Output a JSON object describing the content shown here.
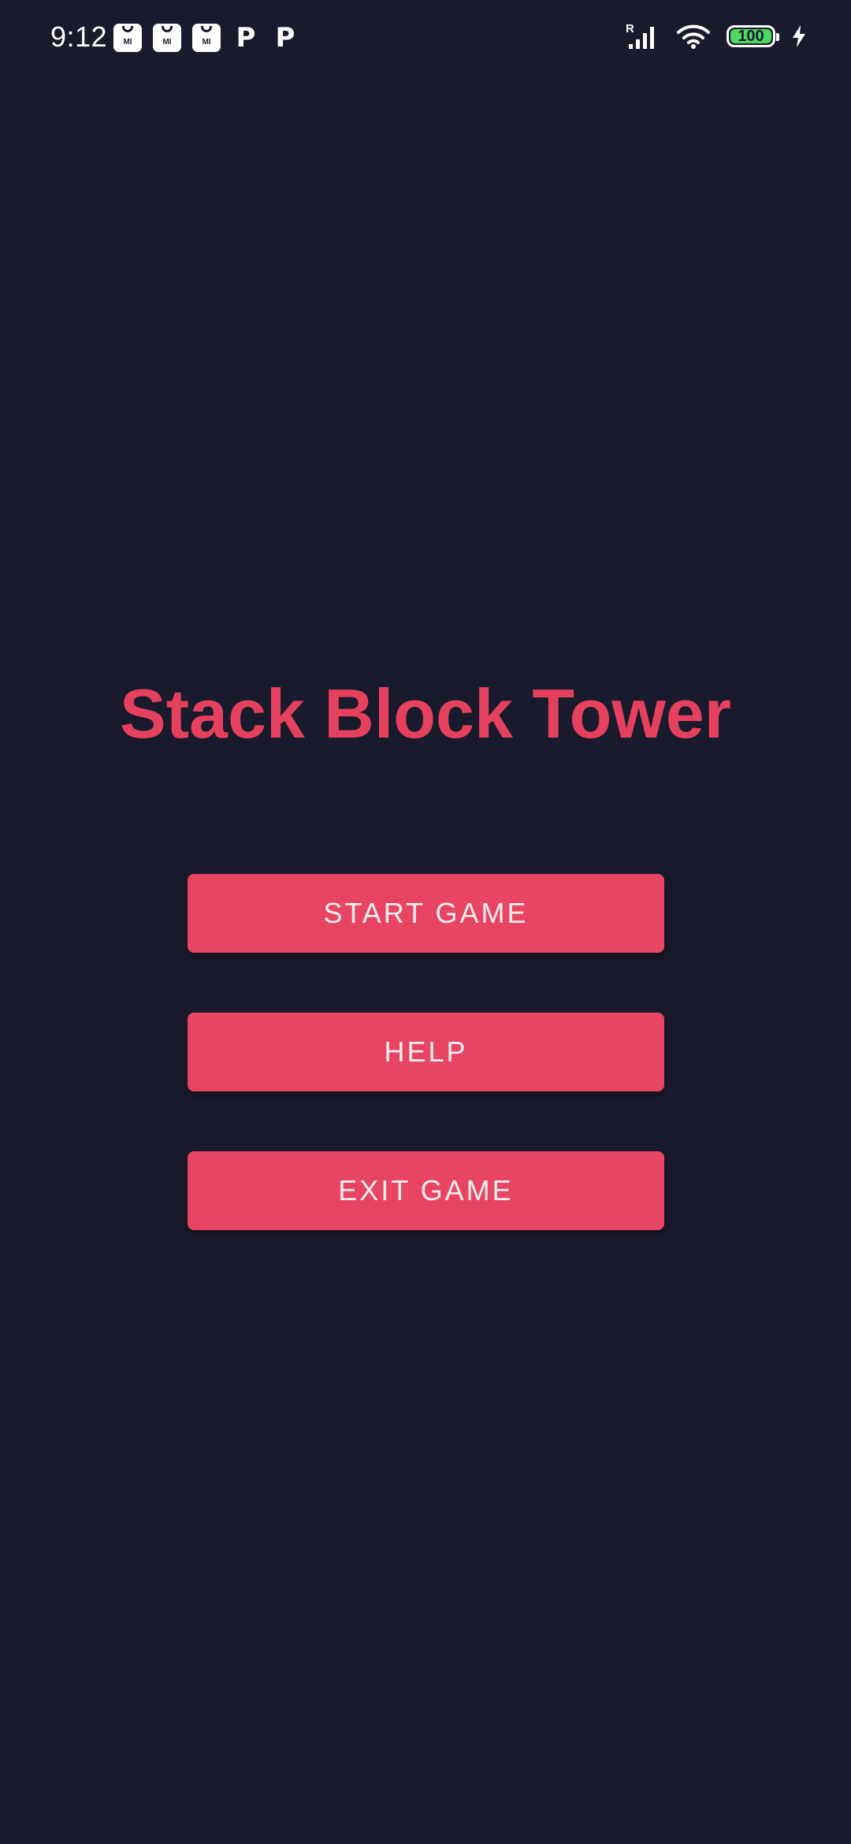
{
  "status_bar": {
    "time": "9:12",
    "notification_icons": [
      "mi-store-icon",
      "mi-store-icon",
      "mi-store-icon",
      "p-app-icon",
      "p-app-icon"
    ],
    "mi_label": "MI",
    "p_label": "P",
    "signal_roaming_label": "R",
    "battery_percent": "100",
    "battery_level": 1.0,
    "charging": true
  },
  "title": "Stack Block Tower",
  "menu": {
    "start_label": "START GAME",
    "help_label": "HELP",
    "exit_label": "EXIT GAME"
  },
  "colors": {
    "background": "#1a1a2d",
    "accent": "#e84562",
    "title": "#e5415f",
    "button_text": "#f8eef0",
    "battery_fill": "#4cd964"
  }
}
